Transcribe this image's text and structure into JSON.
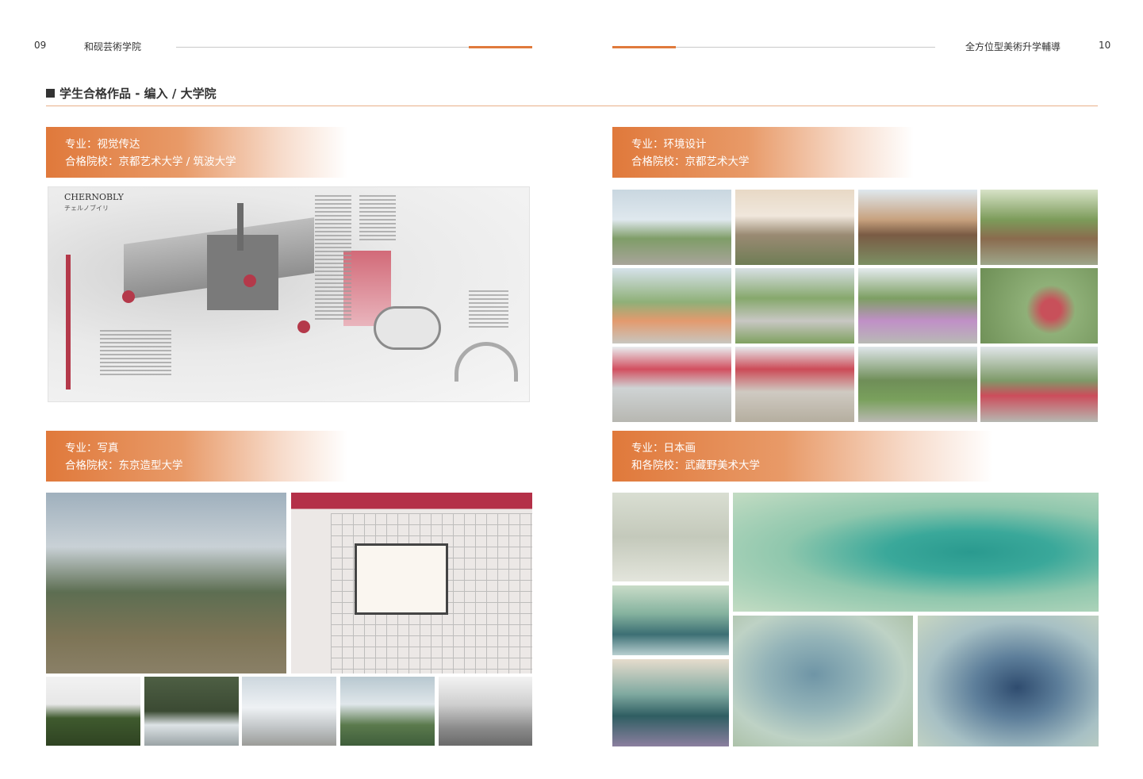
{
  "header": {
    "left_page_num": "09",
    "left_title": "和砚芸術学院",
    "right_title": "全方位型美術升学輔導",
    "right_page_num": "10"
  },
  "section": {
    "title": "学生合格作品 - 编入 / 大学院"
  },
  "blocks": [
    {
      "major": "专业：视觉传达",
      "school": "合格院校：京都艺术大学 / 筑波大学",
      "poster_title": "CHERNOBLY",
      "poster_subtitle": "チェルノブイリ"
    },
    {
      "major": "专业：环境设计",
      "school": "合格院校：京都艺术大学"
    },
    {
      "major": "专业：写真",
      "school": "合格院校：东京造型大学"
    },
    {
      "major": "专业：日本画",
      "school": "和各院校：武藏野美术大学"
    }
  ],
  "colors": {
    "accent": "#e07a3c",
    "text": "#333333"
  }
}
